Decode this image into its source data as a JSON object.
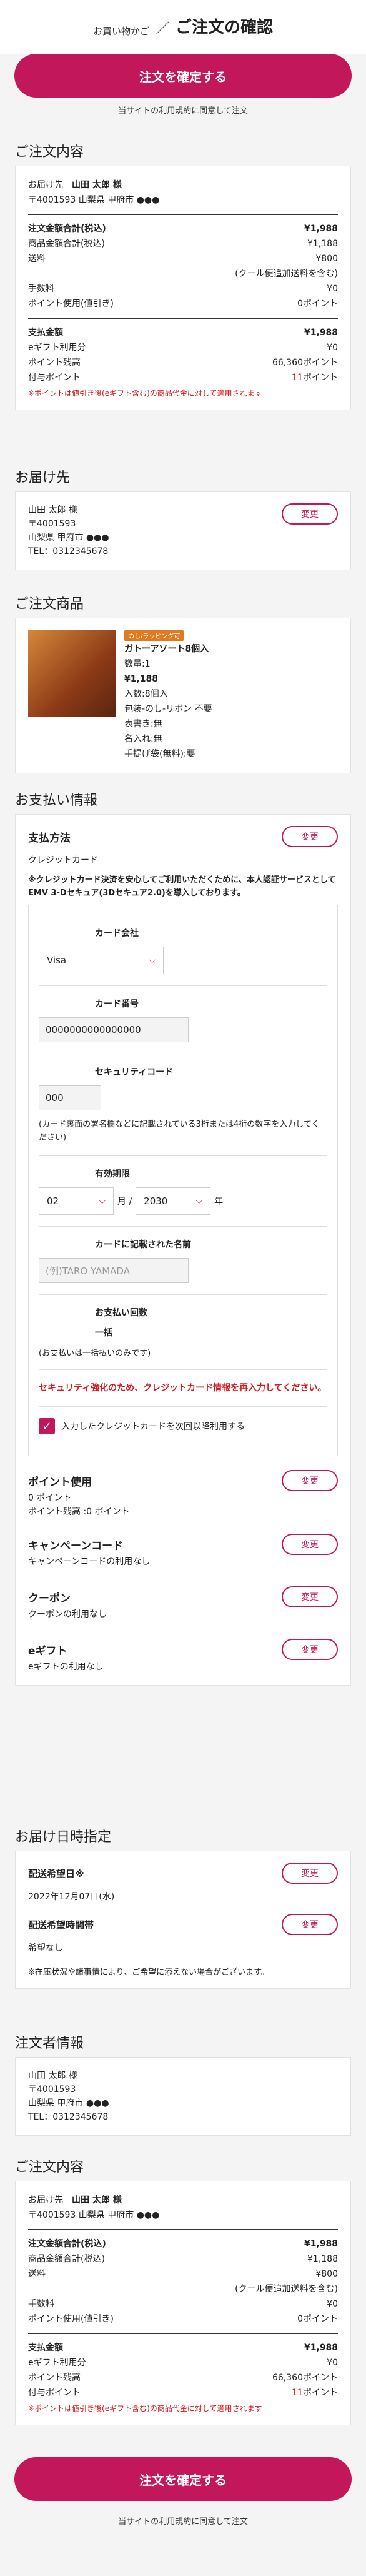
{
  "header": {
    "breadcrumb": "お買い物かご",
    "separator": "／",
    "title": "ご注文の確認"
  },
  "confirm_label": "注文を確定する",
  "terms": {
    "link": "利用規約",
    "prefix": "当サイトの",
    "suffix": "に同意して注文"
  },
  "order_summary": {
    "title": "ご注文内容",
    "dest_label": "お届け先",
    "dest_name": "山田 太郎 様",
    "dest_addr": "〒4001593 山梨県 甲府市 ●●●",
    "total_label": "注文金額合計(税込)",
    "total_value": "¥1,988",
    "goods_label": "商品金額合計(税込)",
    "goods_value": "¥1,188",
    "ship_label": "送料",
    "ship_value": "¥800",
    "ship_note": "(クール便追加送料を含む)",
    "fee_label": "手数料",
    "fee_value": "¥0",
    "point_use_label": "ポイント使用(値引き)",
    "point_use_value": "0ポイント",
    "pay_label": "支払金額",
    "pay_value": "¥1,988",
    "egift_label": "eギフト利用分",
    "egift_value": "¥0",
    "balance_label": "ポイント残高",
    "balance_value": "66,360ポイント",
    "grant_label": "付与ポイント",
    "grant_value": "11",
    "grant_unit": "ポイント",
    "note": "※ポイントは値引き後(eギフト含む)の商品代金に対して適用されます"
  },
  "shipping": {
    "title": "お届け先",
    "name": "山田 太郎 様",
    "zip": "〒4001593",
    "addr": "山梨県 甲府市 ●●●",
    "tel": "TEL：0312345678",
    "change": "変更"
  },
  "product": {
    "title": "ご注文商品",
    "tag": "のし/ラッピング可",
    "name": "ガトーアソート8個入",
    "qty": "数量:1",
    "price": "¥1,188",
    "lines": [
      "入数:8個入",
      "包装-のし-リボン 不要",
      "表書き:無",
      "名入れ:無",
      "手提げ袋(無料):要"
    ]
  },
  "payment": {
    "title": "お支払い情報",
    "method_label": "支払方法",
    "method": "クレジットカード",
    "change": "変更",
    "notice": "※クレジットカード決済を安心してご利用いただくために、本人認証サービスとしてEMV 3-Dセキュア(3Dセキュア2.0)を導入しております。",
    "company_label": "カード会社",
    "company": "Visa",
    "number_label": "カード番号",
    "number": "0000000000000000",
    "code_label": "セキュリティコード",
    "code": "000",
    "code_note": "(カード裏面の署名欄などに記載されている3桁または4桁の数字を入力してください)",
    "expiry_label": "有効期限",
    "month": "02",
    "month_unit": "月 /",
    "year": "2030",
    "year_unit": "年",
    "holder_label": "カードに記載された名前",
    "holder_placeholder": "(例)TARO YAMADA",
    "count_label": "お支払い回数",
    "count": "一括",
    "count_note": "(お支払いは一括払いのみです)",
    "warning": "セキュリティ強化のため、クレジットカード情報を再入力してください。",
    "save_label": "入力したクレジットカードを次回以降利用する"
  },
  "options": [
    {
      "title": "ポイント使用",
      "lines": [
        "0 ポイント",
        "ポイント残高 :0 ポイント"
      ]
    },
    {
      "title": "キャンペーンコード",
      "lines": [
        "キャンペーンコードの利用なし"
      ]
    },
    {
      "title": "クーポン",
      "lines": [
        "クーポンの利用なし"
      ]
    },
    {
      "title": "eギフト",
      "lines": [
        "eギフトの利用なし"
      ]
    }
  ],
  "delivery": {
    "title": "お届け日時指定",
    "date_label": "配送希望日※",
    "date": "2022年12月07日(水)",
    "time_label": "配送希望時間帯",
    "time": "希望なし",
    "note": "※在庫状況や諸事情により、ご希望に添えない場合がございます。"
  },
  "orderer": {
    "title": "注文者情報",
    "name": "山田 太郎 様",
    "zip": "〒4001593",
    "addr": "山梨県 甲府市 ●●●",
    "tel": "TEL：0312345678"
  }
}
